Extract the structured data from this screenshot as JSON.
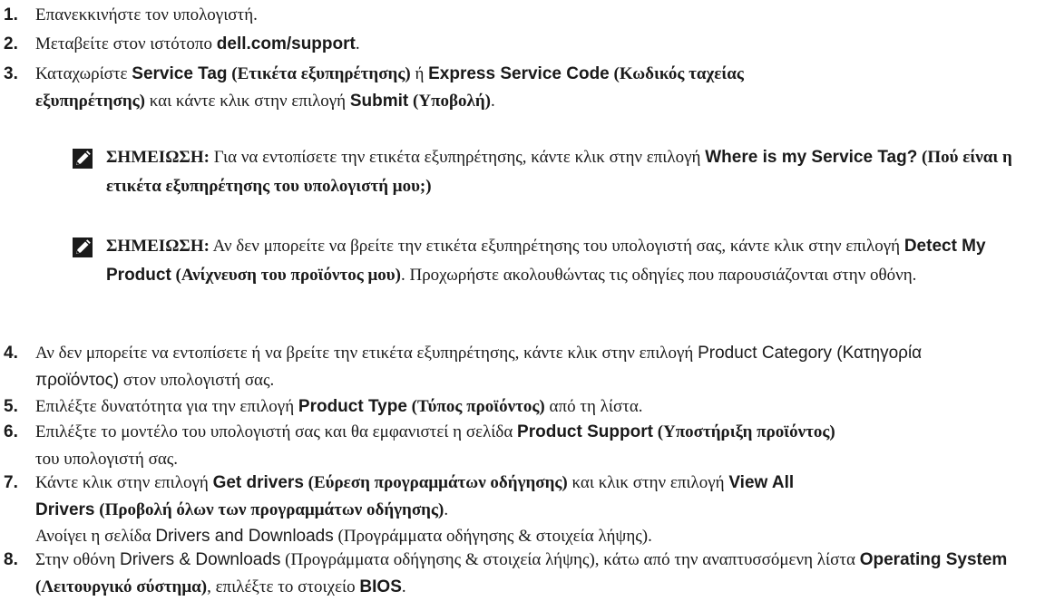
{
  "steps": [
    {
      "number": "1.",
      "parts": [
        "Επανεκκινήστε τον υπολογιστή."
      ]
    },
    {
      "number": "2.",
      "parts": [
        "Μεταβείτε στον ιστότοπο ",
        "dell.com/support",
        "."
      ]
    },
    {
      "number": "3.",
      "parts": [
        "Καταχωρίστε ",
        "Service Tag",
        " (Ετικέτα εξυπηρέτησης)",
        " ή ",
        "Express Service Code",
        " (Κωδικός ταχείας εξυπηρέτησης)",
        " και κάντε κλικ στην επιλογή ",
        "Submit",
        " (Υποβολή)",
        "."
      ]
    },
    {
      "number": "4.",
      "parts": [
        "Αν δεν μπορείτε να εντοπίσετε ή να βρείτε την ετικέτα εξυπηρέτησης, κάντε κλικ στην επιλογή ",
        "Product Category (Κατηγορία προϊόντος)",
        " στον υπολογιστή σας."
      ]
    },
    {
      "number": "5.",
      "parts": [
        "Επιλέξτε δυνατότητα για την επιλογή ",
        "Product Type",
        " (Τύπος προϊόντος)",
        " από τη λίστα."
      ]
    },
    {
      "number": "6.",
      "parts": [
        "Επιλέξτε το μοντέλο του υπολογιστή σας και θα εμφανιστεί η σελίδα ",
        "Product Support",
        " (Υποστήριξη προϊόντος)",
        " του υπολογιστή σας."
      ]
    },
    {
      "number": "7.",
      "parts": [
        "Κάντε κλικ στην επιλογή ",
        "Get drivers",
        " (Εύρεση προγραμμάτων οδήγησης)",
        " και κλικ στην επιλογή ",
        "View All Drivers",
        " (Προβολή όλων των προγραμμάτων οδήγησης)",
        "."
      ],
      "result_parts": [
        "Ανοίγει η σελίδα ",
        "Drivers and Downloads",
        " (Προγράμματα οδήγησης & στοιχεία λήψης)."
      ]
    },
    {
      "number": "8.",
      "parts": [
        "Στην οθόνη ",
        "Drivers & Downloads",
        " (Προγράμματα οδήγησης & στοιχεία λήψης), κάτω από την αναπτυσσόμενη λίστα ",
        "Operating System",
        " (Λειτουργικό σύστημα)",
        ", επιλέξτε το στοιχείο ",
        "BIOS",
        "."
      ]
    }
  ],
  "notes": [
    {
      "label": "ΣΗΜΕΙΩΣΗ:",
      "parts": [
        " Για να εντοπίσετε την ετικέτα εξυπηρέτησης, κάντε κλικ στην επιλογή ",
        "Where is my Service Tag?",
        " (Πού είναι η ετικέτα εξυπηρέτησης του υπολογιστή μου;)"
      ]
    },
    {
      "label": "ΣΗΜΕΙΩΣΗ:",
      "parts": [
        " Αν δεν μπορείτε να βρείτε την ετικέτα εξυπηρέτησης του υπολογιστή σας, κάντε κλικ στην επιλογή ",
        "Detect My Product",
        " (Ανίχνευση του προϊόντος μου)",
        ". Προχωρήστε ακολουθώντας τις οδηγίες που παρουσιάζονται στην οθόνη."
      ]
    }
  ],
  "note_icon": "pencil-icon",
  "colors": {
    "text": "#1a1a1a",
    "icon_fill": "#1a1a1a",
    "background": "#ffffff"
  }
}
